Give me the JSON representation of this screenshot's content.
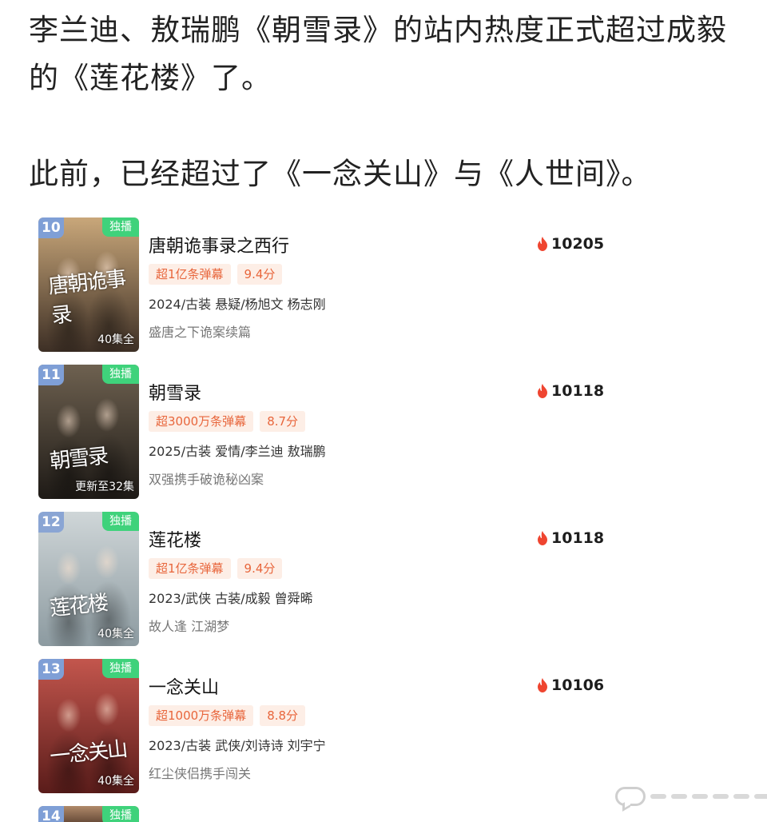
{
  "post": {
    "line1": "李兰迪、敖瑞鹏《朝雪录》的站内热度正式超过成毅",
    "line2": "的《莲花楼》了。",
    "line3": "此前，已经超过了《一念关山》与《人世间》。"
  },
  "colors": {
    "accent_tag_bg": "#fdeee6",
    "accent_tag_text": "#e8663c",
    "exclusive": "#3fd27b",
    "flame": "#ef4530"
  },
  "dramas": [
    {
      "rank": "10",
      "badge": "独播",
      "title": "唐朝诡事录之西行",
      "heat": "10205",
      "danmaku": "超1亿条弹幕",
      "score": "9.4分",
      "meta": "2024/古装 悬疑/杨旭文 杨志刚",
      "desc": "盛唐之下诡案续篇",
      "episodes": "40集全",
      "logo": "唐朝诡事录",
      "poster_colors": [
        "#c9a77a",
        "#3d2f25"
      ],
      "rank_color": "#7f9fd6"
    },
    {
      "rank": "11",
      "badge": "独播",
      "title": "朝雪录",
      "heat": "10118",
      "danmaku": "超3000万条弹幕",
      "score": "8.7分",
      "meta": "2025/古装 爱情/李兰迪 敖瑞鹏",
      "desc": "双强携手破诡秘凶案",
      "episodes": "更新至32集",
      "logo": "朝雪录",
      "poster_colors": [
        "#6e6150",
        "#1e1a16"
      ],
      "rank_color": "#7f9fd6"
    },
    {
      "rank": "12",
      "badge": "独播",
      "title": "莲花楼",
      "heat": "10118",
      "danmaku": "超1亿条弹幕",
      "score": "9.4分",
      "meta": "2023/武侠 古装/成毅 曾舜晞",
      "desc": "故人逢 江湖梦",
      "episodes": "40集全",
      "logo": "莲花楼",
      "poster_colors": [
        "#cfd6d8",
        "#8c9aa0"
      ],
      "rank_color": "#8aa5d4"
    },
    {
      "rank": "13",
      "badge": "独播",
      "title": "一念关山",
      "heat": "10106",
      "danmaku": "超1000万条弹幕",
      "score": "8.8分",
      "meta": "2023/古装 武侠/刘诗诗 刘宇宁",
      "desc": "红尘侠侣携手闯关",
      "episodes": "40集全",
      "logo": "一念关山",
      "poster_colors": [
        "#c3564d",
        "#5a1c1a"
      ],
      "rank_color": "#7f9fd6"
    }
  ],
  "partial": {
    "rank": "14",
    "badge": "独播",
    "poster_colors": [
      "#b08a6a",
      "#6a4d3a"
    ],
    "rank_color": "#7f9fd6"
  }
}
